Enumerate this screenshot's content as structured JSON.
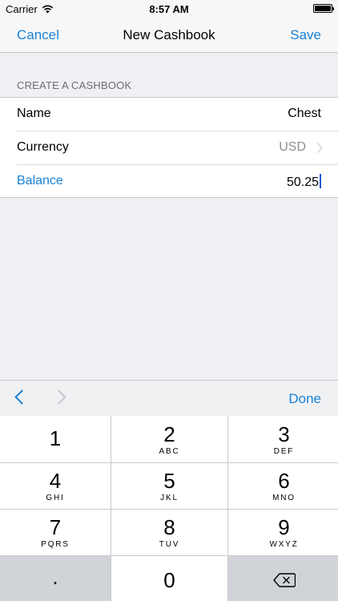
{
  "status_bar": {
    "carrier": "Carrier",
    "time": "8:57 AM"
  },
  "nav": {
    "cancel_label": "Cancel",
    "title": "New Cashbook",
    "save_label": "Save"
  },
  "section": {
    "header": "CREATE A CASHBOOK",
    "rows": [
      {
        "label": "Name",
        "value": "Chest"
      },
      {
        "label": "Currency",
        "value": "USD"
      },
      {
        "label": "Balance",
        "value": "50.25"
      }
    ]
  },
  "accessory": {
    "done_label": "Done"
  },
  "keypad": {
    "keys": [
      {
        "digit": "1",
        "letters": ""
      },
      {
        "digit": "2",
        "letters": "ABC"
      },
      {
        "digit": "3",
        "letters": "DEF"
      },
      {
        "digit": "4",
        "letters": "GHI"
      },
      {
        "digit": "5",
        "letters": "JKL"
      },
      {
        "digit": "6",
        "letters": "MNO"
      },
      {
        "digit": "7",
        "letters": "PQRS"
      },
      {
        "digit": "8",
        "letters": "TUV"
      },
      {
        "digit": "9",
        "letters": "WXYZ"
      },
      {
        "digit": "."
      },
      {
        "digit": "0"
      }
    ]
  },
  "colors": {
    "accent": "#1a82d6",
    "background": "#efeff4"
  }
}
